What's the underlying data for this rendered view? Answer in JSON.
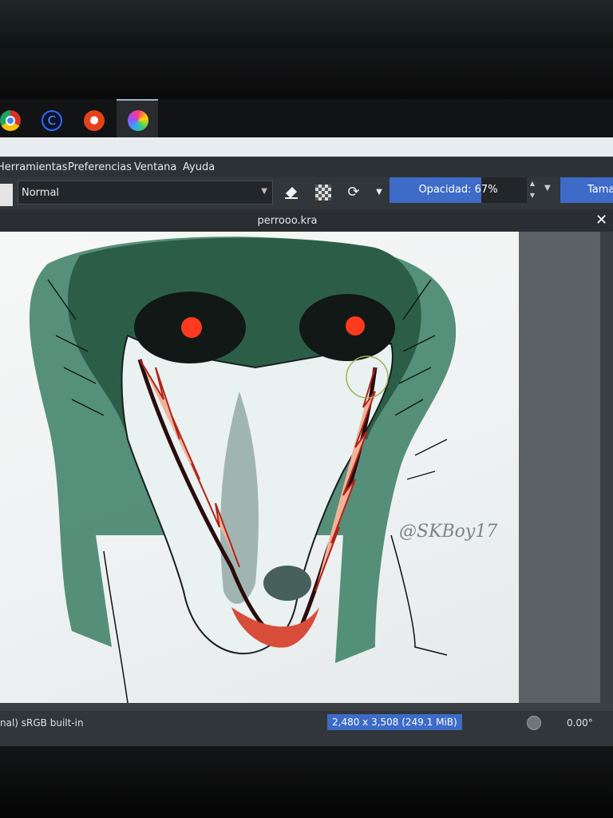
{
  "taskbar": {
    "apps": [
      {
        "icon": "chrome-icon"
      },
      {
        "icon": "ccleaner-icon",
        "glyph": "C"
      },
      {
        "icon": "recorder-icon",
        "glyph": "●"
      },
      {
        "icon": "krita-icon"
      }
    ]
  },
  "menubar": {
    "items": [
      "Herramientas",
      "Preferencias",
      "Ventana",
      "Ayuda"
    ]
  },
  "toolbar": {
    "blend_mode": "Normal",
    "opacity_label": "Opacidad: 67%",
    "opacity_value": 0.67,
    "size_label": "Tama"
  },
  "document": {
    "title": "perrooo.kra",
    "signature": "@SKBoy17"
  },
  "statusbar": {
    "profile": "nal) sRGB built-in",
    "dimensions": "2,480 x 3,508 (249.1 MiB)",
    "rotation": "0.00°"
  },
  "colors": {
    "accent": "#3d6bc7",
    "face_green": "#2f6b52",
    "eye_red": "#ff3b1f",
    "panel": "#31363b"
  }
}
